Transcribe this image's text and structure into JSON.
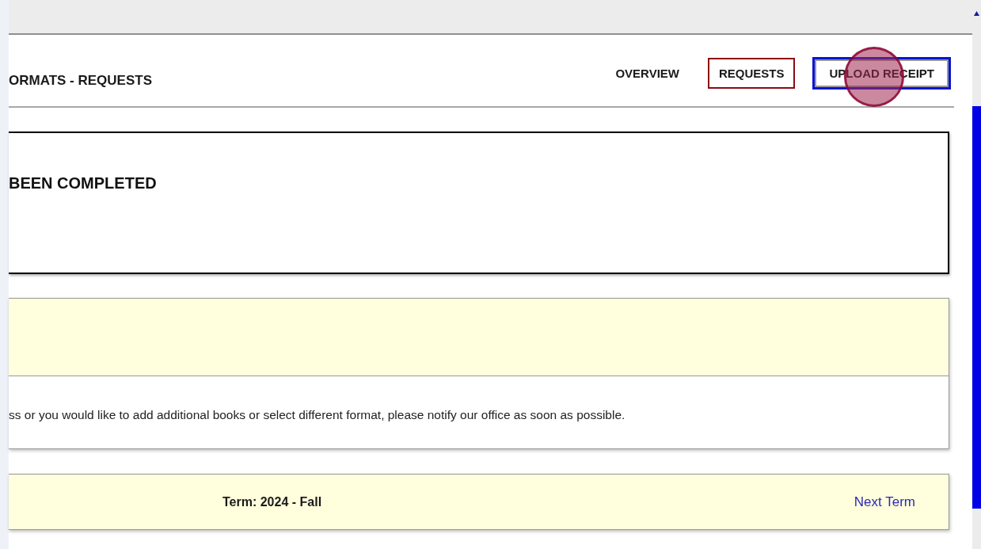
{
  "header": {
    "title": "ORMATS - REQUESTS",
    "tabs": [
      {
        "label": "OVERVIEW",
        "selected": false,
        "focused": false
      },
      {
        "label": "REQUESTS",
        "selected": true,
        "focused": false
      },
      {
        "label": "UPLOAD RECEIPT",
        "selected": false,
        "focused": true
      }
    ]
  },
  "status_card": {
    "heading": "BEEN COMPLETED"
  },
  "notice": {
    "text": "ss or you would like to add additional books or select different format, please notify our office as soon as possible."
  },
  "term_bar": {
    "term": "Term: 2024 - Fall",
    "next_link": "Next Term"
  }
}
